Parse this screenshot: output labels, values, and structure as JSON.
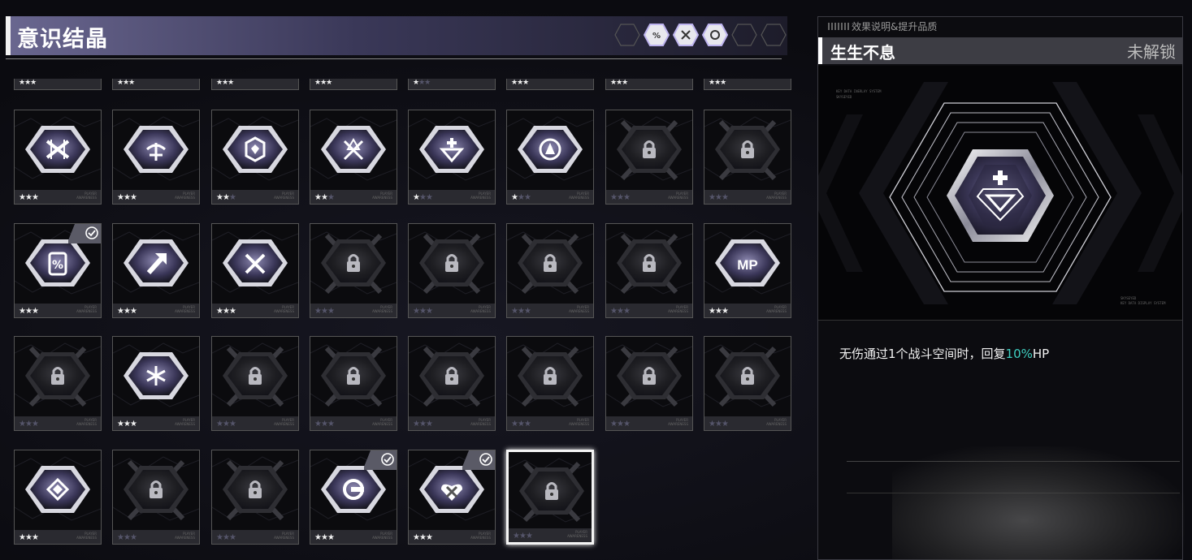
{
  "header": {
    "title": "意识结晶"
  },
  "filters": [
    {
      "icon": "empty-hex-icon",
      "active": false
    },
    {
      "icon": "percent-hex-icon",
      "active": true
    },
    {
      "icon": "swords-hex-icon",
      "active": true
    },
    {
      "icon": "shield-hex-icon",
      "active": true
    },
    {
      "icon": "empty-hex-icon",
      "active": false
    },
    {
      "icon": "empty-hex-icon",
      "active": false
    }
  ],
  "partial_row": [
    {
      "stars": 3
    },
    {
      "stars": 3
    },
    {
      "stars": 3
    },
    {
      "stars": 3
    },
    {
      "stars": 1
    },
    {
      "stars": 3
    },
    {
      "stars": 3
    },
    {
      "stars": 3
    }
  ],
  "crystals": [
    {
      "icon": "swords-cross-icon",
      "unlocked": true,
      "stars": 3,
      "equipped": false,
      "selected": false
    },
    {
      "icon": "heart-leaf-icon",
      "unlocked": true,
      "stars": 3,
      "equipped": false,
      "selected": false
    },
    {
      "icon": "shield-gem-icon",
      "unlocked": true,
      "stars": 2,
      "equipped": false,
      "selected": false
    },
    {
      "icon": "x-blade-icon",
      "unlocked": true,
      "stars": 2,
      "equipped": false,
      "selected": false
    },
    {
      "icon": "plus-diamond-icon",
      "unlocked": true,
      "stars": 1,
      "equipped": false,
      "selected": false
    },
    {
      "icon": "triangle-circle-icon",
      "unlocked": true,
      "stars": 1,
      "equipped": false,
      "selected": false
    },
    {
      "icon": "lock-icon",
      "unlocked": false,
      "stars": 0,
      "equipped": false,
      "selected": false
    },
    {
      "icon": "lock-icon",
      "unlocked": false,
      "stars": 0,
      "equipped": false,
      "selected": false
    },
    {
      "icon": "percent-shield-icon",
      "unlocked": true,
      "stars": 3,
      "equipped": true,
      "selected": false
    },
    {
      "icon": "arrow-up-right-icon",
      "unlocked": true,
      "stars": 3,
      "equipped": false,
      "selected": false
    },
    {
      "icon": "crossed-swords-icon",
      "unlocked": true,
      "stars": 3,
      "equipped": false,
      "selected": false
    },
    {
      "icon": "lock-icon",
      "unlocked": false,
      "stars": 0,
      "equipped": false,
      "selected": false
    },
    {
      "icon": "lock-icon",
      "unlocked": false,
      "stars": 0,
      "equipped": false,
      "selected": false
    },
    {
      "icon": "lock-icon",
      "unlocked": false,
      "stars": 0,
      "equipped": false,
      "selected": false
    },
    {
      "icon": "lock-icon",
      "unlocked": false,
      "stars": 0,
      "equipped": false,
      "selected": false
    },
    {
      "icon": "mp-icon",
      "label": "MP",
      "unlocked": true,
      "stars": 3,
      "equipped": false,
      "selected": false
    },
    {
      "icon": "lock-icon",
      "unlocked": false,
      "stars": 0,
      "equipped": false,
      "selected": false
    },
    {
      "icon": "flower-icon",
      "unlocked": true,
      "stars": 3,
      "equipped": false,
      "selected": false
    },
    {
      "icon": "lock-icon",
      "unlocked": false,
      "stars": 0,
      "equipped": false,
      "selected": false
    },
    {
      "icon": "lock-icon",
      "unlocked": false,
      "stars": 0,
      "equipped": false,
      "selected": false
    },
    {
      "icon": "lock-icon",
      "unlocked": false,
      "stars": 0,
      "equipped": false,
      "selected": false
    },
    {
      "icon": "lock-icon",
      "unlocked": false,
      "stars": 0,
      "equipped": false,
      "selected": false
    },
    {
      "icon": "lock-icon",
      "unlocked": false,
      "stars": 0,
      "equipped": false,
      "selected": false
    },
    {
      "icon": "lock-icon",
      "unlocked": false,
      "stars": 0,
      "equipped": false,
      "selected": false
    },
    {
      "icon": "diamond-emblem-icon",
      "unlocked": true,
      "stars": 3,
      "equipped": false,
      "selected": false
    },
    {
      "icon": "lock-icon",
      "unlocked": false,
      "stars": 0,
      "equipped": false,
      "selected": false
    },
    {
      "icon": "lock-icon",
      "unlocked": false,
      "stars": 0,
      "equipped": false,
      "selected": false
    },
    {
      "icon": "shield-ring-icon",
      "unlocked": true,
      "stars": 3,
      "equipped": true,
      "selected": false
    },
    {
      "icon": "heart-x-icon",
      "unlocked": true,
      "stars": 3,
      "equipped": true,
      "selected": false
    },
    {
      "icon": "lock-icon",
      "unlocked": false,
      "stars": 0,
      "equipped": false,
      "selected": true
    }
  ],
  "detail": {
    "section_label": "效果说明&提升品质",
    "name": "生生不息",
    "status": "未解锁",
    "description_prefix": "无伤通过1个战斗空间时，回复",
    "description_highlight": "10%",
    "description_suffix": "HP",
    "icon": "plus-diamond-icon"
  }
}
